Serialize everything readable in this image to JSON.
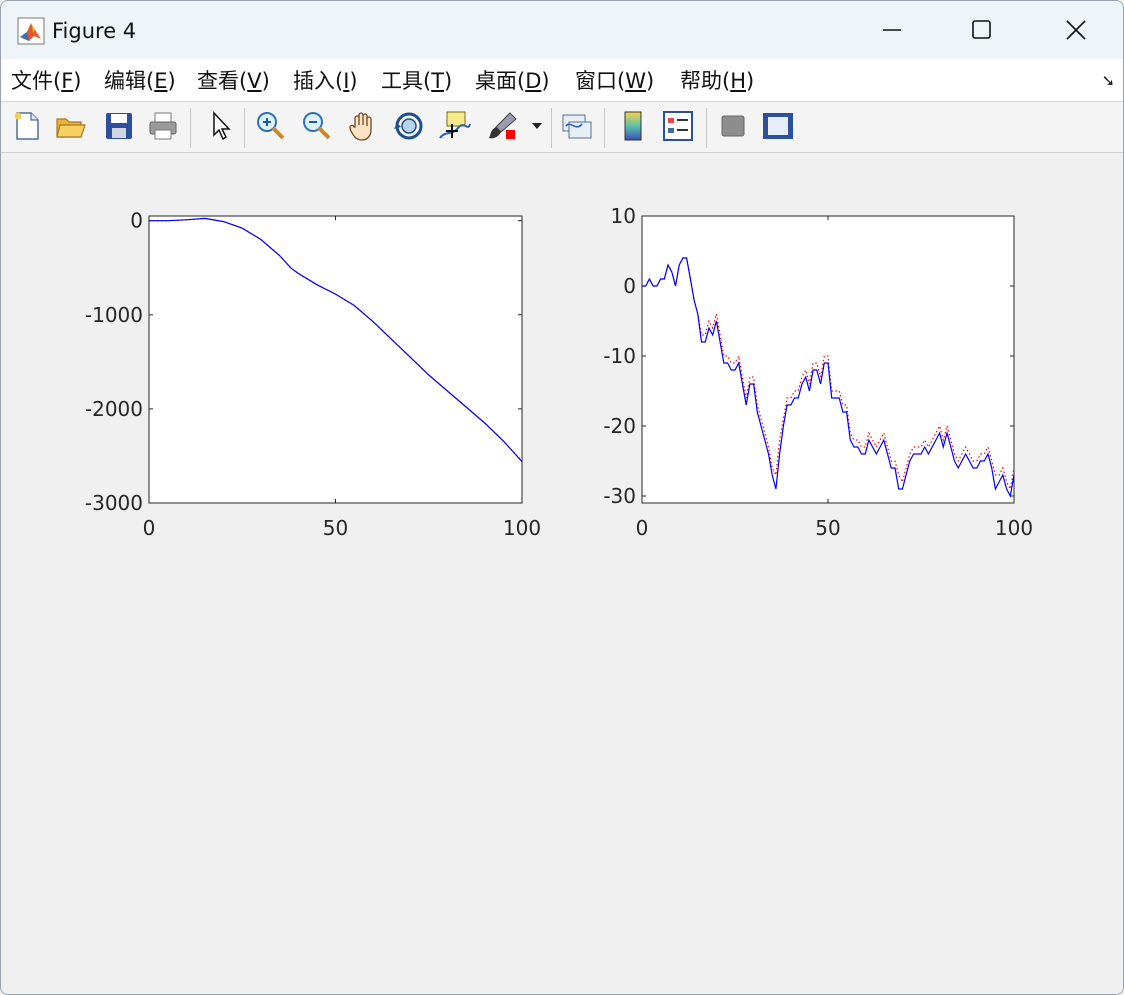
{
  "window": {
    "title": "Figure 4"
  },
  "menu": [
    {
      "label": "文件(F)",
      "pre": "文件(",
      "key": "F",
      "post": ")"
    },
    {
      "label": "编辑(E)",
      "pre": "编辑(",
      "key": "E",
      "post": ")"
    },
    {
      "label": "查看(V)",
      "pre": "查看(",
      "key": "V",
      "post": ")"
    },
    {
      "label": "插入(I)",
      "pre": "插入(",
      "key": "I",
      "post": ")"
    },
    {
      "label": "工具(T)",
      "pre": "工具(",
      "key": "T",
      "post": ")"
    },
    {
      "label": "桌面(D)",
      "pre": "桌面(",
      "key": "D",
      "post": ")"
    },
    {
      "label": "窗口(W)",
      "pre": "窗口(",
      "key": "W",
      "post": ")"
    },
    {
      "label": "帮助(H)",
      "pre": "帮助(",
      "key": "H",
      "post": ")"
    }
  ],
  "toolbar": [
    "new-figure-icon",
    "open-file-icon",
    "save-icon",
    "print-icon",
    "pointer-icon",
    "zoom-in-icon",
    "zoom-out-icon",
    "pan-icon",
    "rotate-3d-icon",
    "data-cursor-icon",
    "brush-icon",
    "link-plot-icon",
    "colorbar-icon",
    "legend-icon",
    "hide-plot-tools-icon",
    "show-plot-tools-icon"
  ],
  "colors": {
    "blue_line": "#0000ff",
    "red_dotted": "#ff0000"
  },
  "chart_data": [
    {
      "type": "line",
      "xlim": [
        0,
        100
      ],
      "ylim": [
        -3000,
        50
      ],
      "xticks": [
        "0",
        "50",
        "100"
      ],
      "yticks": [
        "0",
        "-1000",
        "-2000",
        "-3000"
      ],
      "xtick_values": [
        0,
        50,
        100
      ],
      "ytick_values": [
        0,
        -1000,
        -2000,
        -3000
      ],
      "series": [
        {
          "style": "solid",
          "color": "#0000ff",
          "x": [
            0,
            5,
            10,
            15,
            20,
            25,
            30,
            35,
            38,
            40,
            45,
            50,
            55,
            60,
            65,
            70,
            75,
            80,
            85,
            90,
            95,
            100
          ],
          "y": [
            0,
            0,
            10,
            25,
            -10,
            -80,
            -200,
            -370,
            -500,
            -560,
            -680,
            -780,
            -900,
            -1070,
            -1260,
            -1450,
            -1640,
            -1810,
            -1980,
            -2150,
            -2340,
            -2560
          ]
        },
        {
          "style": "dotted",
          "color": "#ff0000",
          "x": [
            0,
            5,
            10,
            15,
            20,
            25,
            30,
            35,
            38,
            40,
            45,
            50,
            55,
            60,
            65,
            70,
            75,
            80,
            85,
            90,
            95,
            100
          ],
          "y": [
            0,
            0,
            10,
            25,
            -10,
            -80,
            -200,
            -370,
            -500,
            -560,
            -680,
            -780,
            -900,
            -1070,
            -1260,
            -1450,
            -1640,
            -1810,
            -1980,
            -2150,
            -2340,
            -2555
          ]
        }
      ]
    },
    {
      "type": "line",
      "xlim": [
        0,
        100
      ],
      "ylim": [
        -31,
        10
      ],
      "xticks": [
        "0",
        "50",
        "100"
      ],
      "yticks": [
        "10",
        "0",
        "-10",
        "-20",
        "-30"
      ],
      "xtick_values": [
        0,
        50,
        100
      ],
      "ytick_values": [
        10,
        0,
        -10,
        -20,
        -30
      ],
      "series": [
        {
          "style": "solid",
          "color": "#0000ff",
          "x": [
            0,
            1,
            2,
            3,
            4,
            5,
            6,
            7,
            8,
            9,
            10,
            11,
            12,
            13,
            14,
            15,
            16,
            17,
            18,
            19,
            20,
            21,
            22,
            23,
            24,
            25,
            26,
            27,
            28,
            29,
            30,
            31,
            32,
            33,
            34,
            35,
            36,
            37,
            38,
            39,
            40,
            41,
            42,
            43,
            44,
            45,
            46,
            47,
            48,
            49,
            50,
            51,
            52,
            53,
            54,
            55,
            56,
            57,
            58,
            59,
            60,
            61,
            62,
            63,
            64,
            65,
            66,
            67,
            68,
            69,
            70,
            71,
            72,
            73,
            74,
            75,
            76,
            77,
            78,
            79,
            80,
            81,
            82,
            83,
            84,
            85,
            86,
            87,
            88,
            89,
            90,
            91,
            92,
            93,
            94,
            95,
            96,
            97,
            98,
            99,
            100
          ],
          "y": [
            0,
            0,
            1,
            0,
            0,
            1,
            1,
            3,
            2,
            0,
            3,
            4,
            4,
            1,
            -2,
            -4,
            -8,
            -8,
            -6,
            -7,
            -5,
            -8,
            -11,
            -11,
            -12,
            -12,
            -11,
            -14,
            -17,
            -14,
            -14,
            -18,
            -20,
            -22,
            -24,
            -27,
            -29,
            -24,
            -20,
            -17,
            -17,
            -16,
            -16,
            -14,
            -13,
            -15,
            -12,
            -12,
            -14,
            -11,
            -11,
            -16,
            -16,
            -16,
            -18,
            -18,
            -22,
            -23,
            -23,
            -24,
            -24,
            -22,
            -23,
            -24,
            -23,
            -22,
            -24,
            -26,
            -26,
            -29,
            -29,
            -27,
            -25,
            -24,
            -24,
            -24,
            -23,
            -24,
            -23,
            -22,
            -21,
            -23,
            -21,
            -23,
            -25,
            -26,
            -25,
            -24,
            -25,
            -26,
            -26,
            -25,
            -25,
            -24,
            -26,
            -29,
            -28,
            -27,
            -29,
            -30,
            -27
          ]
        },
        {
          "style": "dotted",
          "color": "#ff0000",
          "x": [
            0,
            1,
            2,
            3,
            4,
            5,
            6,
            7,
            8,
            9,
            10,
            11,
            12,
            13,
            14,
            15,
            16,
            17,
            18,
            19,
            20,
            21,
            22,
            23,
            24,
            25,
            26,
            27,
            28,
            29,
            30,
            31,
            32,
            33,
            34,
            35,
            36,
            37,
            38,
            39,
            40,
            41,
            42,
            43,
            44,
            45,
            46,
            47,
            48,
            49,
            50,
            51,
            52,
            53,
            54,
            55,
            56,
            57,
            58,
            59,
            60,
            61,
            62,
            63,
            64,
            65,
            66,
            67,
            68,
            69,
            70,
            71,
            72,
            73,
            74,
            75,
            76,
            77,
            78,
            79,
            80,
            81,
            82,
            83,
            84,
            85,
            86,
            87,
            88,
            89,
            90,
            91,
            92,
            93,
            94,
            95,
            96,
            97,
            98,
            99,
            100
          ],
          "y": [
            0,
            0,
            1,
            0,
            0,
            1,
            1,
            3,
            2,
            0,
            3,
            4,
            4,
            1,
            -2,
            -4,
            -7,
            -7,
            -5,
            -6,
            -4,
            -7,
            -10,
            -10,
            -11,
            -11,
            -10,
            -13,
            -16,
            -13,
            -13,
            -17,
            -19,
            -21,
            -23,
            -26,
            -27,
            -22,
            -19,
            -16,
            -16,
            -15,
            -15,
            -13,
            -12,
            -14,
            -11,
            -11,
            -13,
            -10,
            -10,
            -15,
            -15,
            -15,
            -17,
            -17,
            -21,
            -22,
            -22,
            -23,
            -23,
            -21,
            -22,
            -23,
            -22,
            -21,
            -23,
            -25,
            -25,
            -27,
            -28,
            -26,
            -24,
            -23,
            -23,
            -23,
            -22,
            -23,
            -22,
            -21,
            -20,
            -22,
            -20,
            -22,
            -24,
            -25,
            -24,
            -23,
            -24,
            -25,
            -25,
            -24,
            -24,
            -23,
            -25,
            -27,
            -27,
            -26,
            -28,
            -29,
            -26
          ]
        }
      ]
    }
  ]
}
